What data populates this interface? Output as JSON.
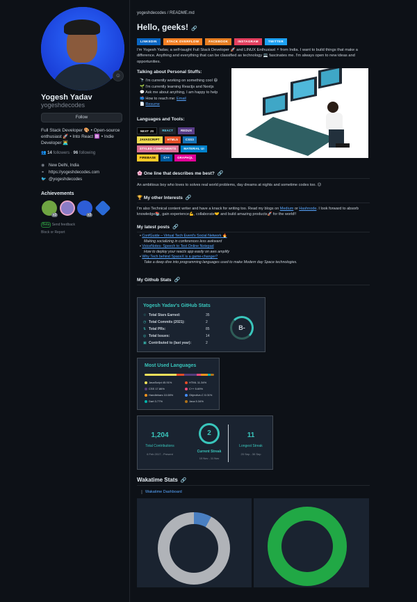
{
  "profile": {
    "name": "Yogesh Yadav",
    "handle": "yogeshdecodes",
    "follow_label": "Follow",
    "bio": "Full Stack Developer 🎨 • Open-source enthusiast 🚀 • Into React ⚛️ • Indie Developer 👨‍💻",
    "followers_count": "14",
    "followers_label": "followers",
    "following_count": "96",
    "following_label": "following",
    "location": "New Delhi, India",
    "website": "https://yogeshdecodes.com",
    "twitter": "@yogeshdecodes",
    "achievements_title": "Achievements",
    "achievement_badges": [
      {
        "multiplier": "x3"
      },
      {
        "multiplier": "x3"
      }
    ],
    "beta_label": "Beta",
    "feedback_label": "Send feedback",
    "block_label": "Block or Report"
  },
  "readme": {
    "path": "yogeshdecodes / README.md",
    "title": "Hello, geeks!",
    "badges": [
      {
        "label": "LINKEDIN",
        "color": "#0a66c2"
      },
      {
        "label": "STACK OVERFLOW",
        "color": "#f48024"
      },
      {
        "label": "FACEBOOK",
        "color": "#e67e22"
      },
      {
        "label": "INSTAGRAM",
        "color": "#e4405f"
      },
      {
        "label": "TWITTER",
        "color": "#1da1f2"
      }
    ],
    "intro": "I'm Yogesh Yadav, a self-taught Full Stack Developer 🚀 and LINUX Enthusiast ⚡ from India. I want to build things that make a difference. Anything and everything that can be classified as technology 💻 fascinates me. I'm always open to new ideas and opportunities.",
    "personal_title": "Talking about Personal Stuffs:",
    "personal_items": [
      "🔭 I'm currently working on something cool 😄",
      "🌱 I'm currently learning Reactjs and Nextjs",
      "💬 Ask me about anything, I am happy to help",
      "📫 How to reach me: ",
      "📄 Resume"
    ],
    "email_link": "Email",
    "resume_link": "Resume",
    "lang_title": "Languages and Tools:",
    "tech_rows": [
      [
        {
          "label": "NEXT JS",
          "color": "#000000"
        },
        {
          "label": "REACT",
          "color": "#20232a"
        },
        {
          "label": "REDUX",
          "color": "#593d88"
        }
      ],
      [
        {
          "label": "JAVASCRIPT",
          "color": "#f0db4f"
        },
        {
          "label": "HTML5",
          "color": "#e34f26"
        },
        {
          "label": "CSS3",
          "color": "#1572b6"
        }
      ],
      [
        {
          "label": "STYLED COMPONENTS",
          "color": "#db7093"
        },
        {
          "label": "MATERIAL UI",
          "color": "#0081cb"
        }
      ],
      [
        {
          "label": "FIREBASE",
          "color": "#ffca28"
        },
        {
          "label": "C++",
          "color": "#00599c"
        },
        {
          "label": "GRAPHQL",
          "color": "#e10098"
        }
      ]
    ],
    "oneline_title": "🌸 One line that describes me best?",
    "oneline_text": "An ambitious boy who loves to solves real world problems, day dreams at nights and sometime codes too. 😉",
    "interests_title": "🏆 My other Interests",
    "interests_pre": "I'm also Technical content writer and have a knack for writing too. Read my blogs on ",
    "interests_link1": "Medium",
    "interests_mid": " or ",
    "interests_link2": "Hashnode",
    "interests_post": ". I look forward to absorb knowledge📚, gain experience💪, collaborate🤝 and build amazing products🚀 for the world!!",
    "posts_title": "My latest posts",
    "posts": [
      {
        "title": "ConfGuide – Virtual Tech Event's Social Network 🔥",
        "desc": "Making socializing in conferences less awkward"
      },
      {
        "title": "VoiceNotes- Speech to Text Online Notepad",
        "desc": "How to deploy your reacts app easily on aws amplify"
      },
      {
        "title": "Why Tech behind SpaceX is a game-changer?",
        "desc": "Take a deep dive into programming languages used to make Modern day Space technologies."
      }
    ],
    "github_stats_title": "My Github Stats"
  },
  "stats_card": {
    "title": "Yogesh Yadav's GitHub Stats",
    "rows": [
      {
        "label": "Total Stars Earned:",
        "value": "35"
      },
      {
        "label": "Total Commits (2021):",
        "value": "2"
      },
      {
        "label": "Total PRs:",
        "value": "85"
      },
      {
        "label": "Total Issues:",
        "value": "14"
      },
      {
        "label": "Contributed to (last year):",
        "value": "2"
      }
    ],
    "grade": "B-"
  },
  "langs_card": {
    "title": "Most Used Languages",
    "items": [
      {
        "name": "JavaScript 45.91%",
        "color": "#f1e05a",
        "percent": 45.91
      },
      {
        "name": "HTML 11.34%",
        "color": "#e34c26",
        "percent": 11.34
      },
      {
        "name": "CSS 17.86%",
        "color": "#563d7c",
        "percent": 17.86
      },
      {
        "name": "C++ 5.69%",
        "color": "#f34b7d",
        "percent": 5.69
      },
      {
        "name": "Handlebars 10.08%",
        "color": "#f7931e",
        "percent": 10.08
      },
      {
        "name": "Objective-C 0.01%",
        "color": "#438eff",
        "percent": 0.01
      },
      {
        "name": "Dart 3.77%",
        "color": "#00b4ab",
        "percent": 3.77
      },
      {
        "name": "Java 5.34%",
        "color": "#b07219",
        "percent": 5.34
      }
    ]
  },
  "streak_card": {
    "total_value": "1,204",
    "total_label": "Total Contributions",
    "total_range": "6 Feb 2017 - Present",
    "current_value": "2",
    "current_label": "Current Streak",
    "current_range": "10 Nov - 11 Nov",
    "longest_value": "11",
    "longest_label": "Longest Streak",
    "longest_range": "20 Sep - 30 Sep"
  },
  "wakatime": {
    "title": "Wakatime Stats",
    "link": "Wakatime Dashboard"
  },
  "colors": {
    "accent": "#39c5bb",
    "link": "#58a6ff",
    "bg": "#0d1117"
  }
}
